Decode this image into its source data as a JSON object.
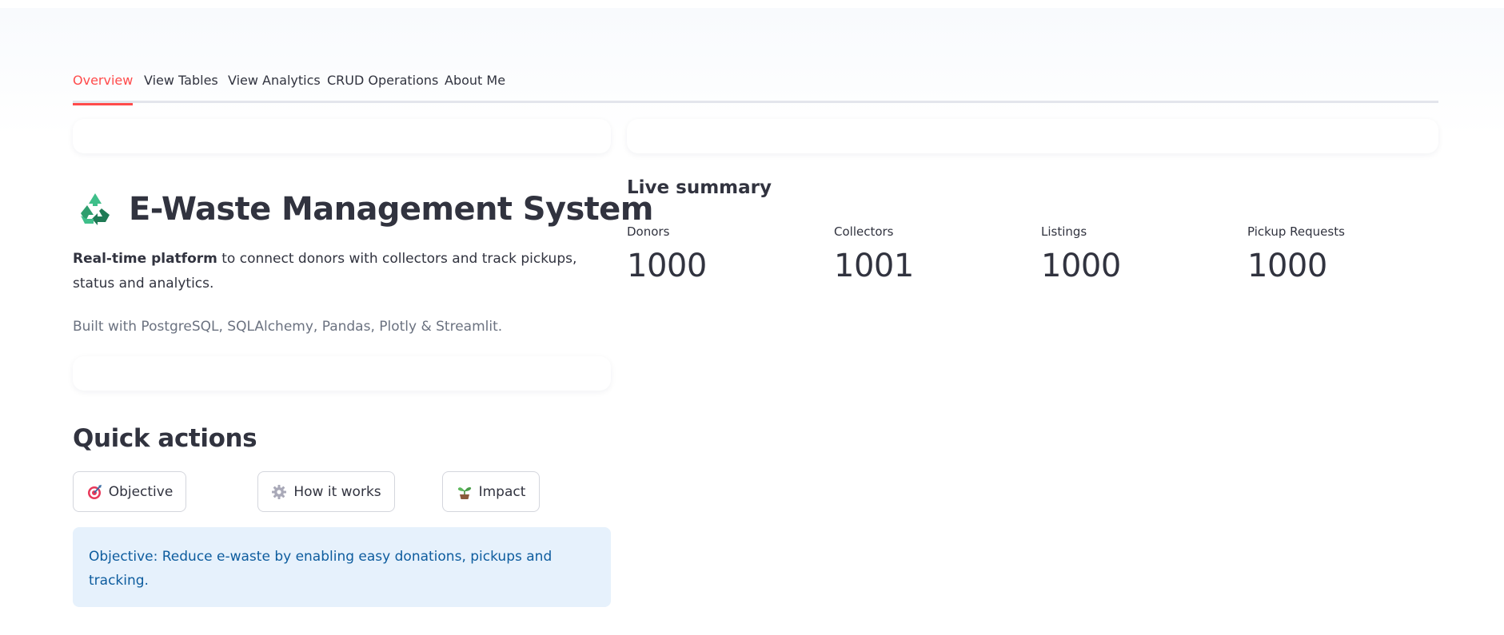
{
  "tabs": [
    {
      "label": "Overview",
      "active": true
    },
    {
      "label": "View Tables",
      "active": false
    },
    {
      "label": "View Analytics",
      "active": false
    },
    {
      "label": "CRUD Operations",
      "active": false
    },
    {
      "label": "About Me",
      "active": false
    }
  ],
  "hero": {
    "icon": "recycle-icon",
    "title": "E-Waste Management System",
    "desc_bold": "Real-time platform",
    "desc_rest": " to connect donors with collectors and track pickups, status and analytics.",
    "built_with": "Built with PostgreSQL, SQLAlchemy, Pandas, Plotly & Streamlit."
  },
  "quick_actions": {
    "title": "Quick actions",
    "buttons": [
      {
        "label": "Objective",
        "icon": "target-icon"
      },
      {
        "label": "How it works",
        "icon": "gear-icon"
      },
      {
        "label": "Impact",
        "icon": "seedling-icon"
      }
    ],
    "info": "Objective: Reduce e-waste by enabling easy donations, pickups and tracking."
  },
  "summary": {
    "title": "Live summary",
    "metrics": [
      {
        "label": "Donors",
        "value": "1000"
      },
      {
        "label": "Collectors",
        "value": "1001"
      },
      {
        "label": "Listings",
        "value": "1000"
      },
      {
        "label": "Pickup Requests",
        "value": "1000"
      }
    ]
  },
  "colors": {
    "accent": "#ff4b4b",
    "info_bg": "#e6f1fc",
    "info_text": "#0d5c9e",
    "text": "#31333f",
    "muted": "#6b7280"
  }
}
